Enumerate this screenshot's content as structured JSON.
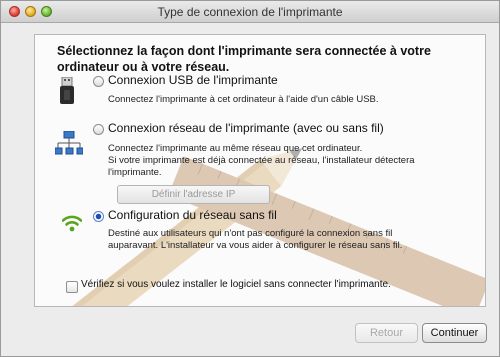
{
  "window": {
    "title": "Type de connexion de l'imprimante"
  },
  "main": {
    "heading_line1": "Sélectionnez la façon dont l'imprimante sera connectée à votre",
    "heading_line2": "ordinateur ou à votre réseau.",
    "options": [
      {
        "label": "Connexion USB de l'imprimante",
        "selected": false,
        "icon": "usb-icon",
        "description": [
          "Connectez l'imprimante à cet ordinateur à l'aide d'un câble USB."
        ]
      },
      {
        "label": "Connexion réseau de l'imprimante (avec ou sans fil)",
        "selected": false,
        "icon": "network-icon",
        "description": [
          "Connectez l'imprimante au même réseau que cet ordinateur.",
          "Si votre imprimante est déjà connectée au réseau, l'installateur détectera",
          "l'imprimante."
        ],
        "button_label": "Définir l'adresse IP"
      },
      {
        "label": "Configuration du réseau sans fil",
        "selected": true,
        "icon": "wifi-icon",
        "description": [
          "Destiné aux utilisateurs qui n'ont pas configuré la connexion sans fil",
          "auparavant. L'installateur va vous aider à configurer le réseau sans fil."
        ]
      }
    ],
    "checkbox_label": "Vérifiez si vous voulez installer le logiciel sans connecter l'imprimante.",
    "checkbox_checked": false
  },
  "footer": {
    "back_label": "Retour",
    "next_label": "Continuer"
  },
  "colors": {
    "radio_selected": "#1a4fb5",
    "wifi_green": "#5aa51e"
  }
}
